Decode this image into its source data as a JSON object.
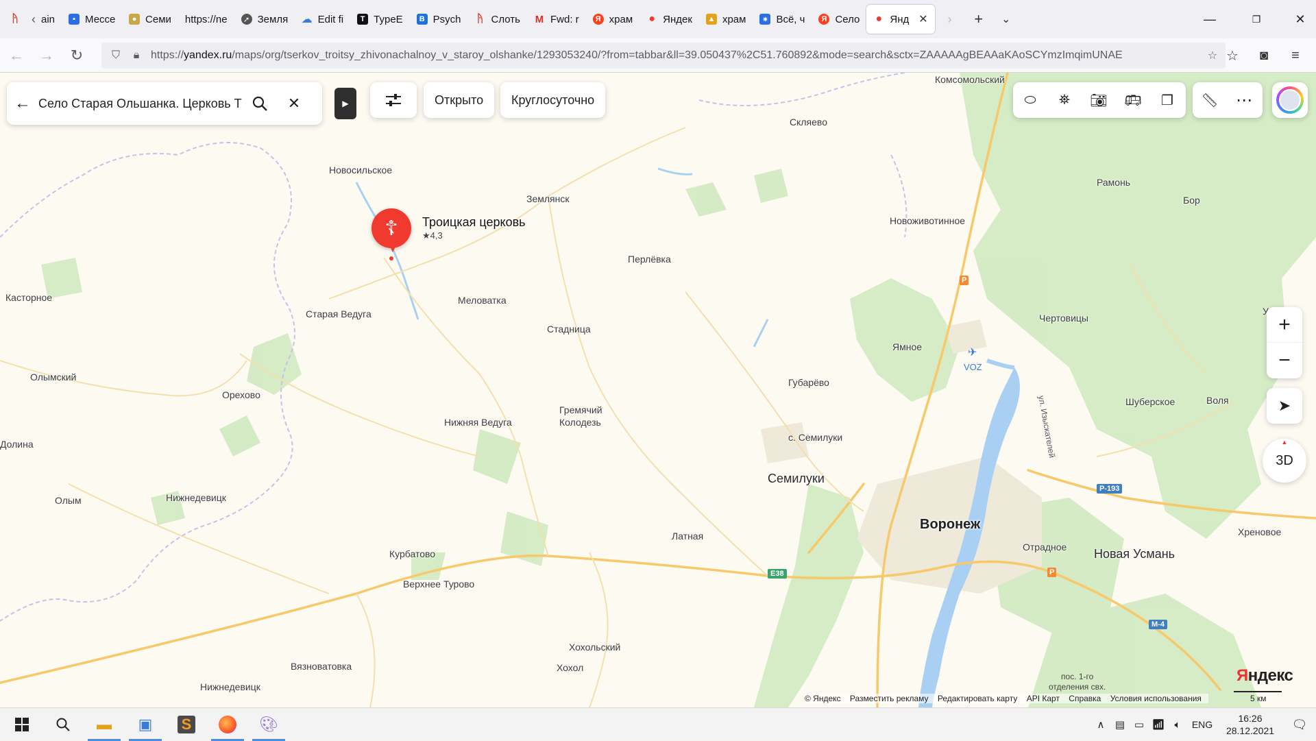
{
  "browser": {
    "tabs": [
      {
        "title": "",
        "icon": "red-figure-icon",
        "color": "#d93a2b"
      },
      {
        "title": "ain",
        "icon": "chevron-left-icon",
        "color": "#555555"
      },
      {
        "title": "Мессе",
        "icon": "message-icon",
        "color": "#2a6ee8"
      },
      {
        "title": "Семи",
        "icon": "bread-icon",
        "color": "#c9a84a"
      },
      {
        "title": "https://ne",
        "icon": "",
        "color": ""
      },
      {
        "title": "Земля",
        "icon": "rocket-icon",
        "color": "#555555"
      },
      {
        "title": "Edit fi",
        "icon": "cloud-icon",
        "color": "#3a7bd5"
      },
      {
        "title": "TypeE",
        "icon": "typeset-icon",
        "color": "#111111"
      },
      {
        "title": "Psych",
        "icon": "psych-icon",
        "color": "#1e73d8"
      },
      {
        "title": "Слоть",
        "icon": "red-figure-icon",
        "color": "#d93a2b"
      },
      {
        "title": "Fwd: r",
        "icon": "gmail-icon",
        "color": "#d93025"
      },
      {
        "title": "храм",
        "icon": "yandex-icon",
        "color": "#fc3f1d"
      },
      {
        "title": "Яндек",
        "icon": "map-pin-icon",
        "color": "#f03a2f"
      },
      {
        "title": "храм",
        "icon": "image-search-icon",
        "color": "#e3a21a"
      },
      {
        "title": "Всё, ч",
        "icon": "sparkle-icon",
        "color": "#2a6ee8"
      },
      {
        "title": "Село",
        "icon": "yandex-icon",
        "color": "#fc3f1d"
      }
    ],
    "active_tab": {
      "title": "Янд",
      "icon": "map-pin-icon",
      "color": "#f03a2f",
      "close": "✕"
    },
    "url": {
      "protocol": "https://",
      "host": "yandex.ru",
      "path": "/maps/org/tserkov_troitsy_zhivonachalnoy_v_staroy_olshanke/1293053240/?from=tabbar&ll=39.050437%2C51.760892&mode=search&sctx=ZAAAAAgBEAAaKAoSCYmzImqimUNAE"
    }
  },
  "map": {
    "search": {
      "value": "Село Старая Ольшанка. Церковь Т"
    },
    "chips": [
      "Открыто",
      "Круглосуточно"
    ],
    "place": {
      "title": "Троицкая церковь",
      "rating": "★4,3"
    },
    "labels": [
      {
        "text": "Комсомольский",
        "kind": "town"
      },
      {
        "text": "Скляево",
        "kind": "town"
      },
      {
        "text": "Новосильское",
        "kind": "town"
      },
      {
        "text": "Землянск",
        "kind": "town"
      },
      {
        "text": "Рамонь",
        "kind": "town"
      },
      {
        "text": "Бор",
        "kind": "town"
      },
      {
        "text": "Новоживотинное",
        "kind": "town"
      },
      {
        "text": "Перлёвка",
        "kind": "town"
      },
      {
        "text": "Касторное",
        "kind": "town"
      },
      {
        "text": "Старая Ведуга",
        "kind": "town"
      },
      {
        "text": "Меловатка",
        "kind": "town"
      },
      {
        "text": "Стадница",
        "kind": "town"
      },
      {
        "text": "Чертовицы",
        "kind": "town"
      },
      {
        "text": "Ямное",
        "kind": "town"
      },
      {
        "text": "Олымский",
        "kind": "town"
      },
      {
        "text": "Орехово",
        "kind": "town"
      },
      {
        "text": "Губарёво",
        "kind": "town"
      },
      {
        "text": "Шуберское",
        "kind": "town"
      },
      {
        "text": "Воля",
        "kind": "town"
      },
      {
        "text": "Нижняя Ведуга",
        "kind": "town"
      },
      {
        "text": "Гремячий",
        "kind": "town"
      },
      {
        "text": "Колодезь",
        "kind": "town"
      },
      {
        "text": "с. Семилуки",
        "kind": "town"
      },
      {
        "text": "Долина",
        "kind": "town"
      },
      {
        "text": "Семилуки",
        "kind": "city"
      },
      {
        "text": "Олым",
        "kind": "town"
      },
      {
        "text": "Нижнедевицк",
        "kind": "town"
      },
      {
        "text": "Латная",
        "kind": "town"
      },
      {
        "text": "Воронеж",
        "kind": "bigcity"
      },
      {
        "text": "Хреновое",
        "kind": "town"
      },
      {
        "text": "Отрадное",
        "kind": "town"
      },
      {
        "text": "Новая Усмань",
        "kind": "city"
      },
      {
        "text": "Курбатово",
        "kind": "town"
      },
      {
        "text": "Верхнее Турово",
        "kind": "town"
      },
      {
        "text": "Хохольский",
        "kind": "town"
      },
      {
        "text": "Хохол",
        "kind": "town"
      },
      {
        "text": "Вязноватовка",
        "kind": "town"
      },
      {
        "text": "Нижнедевицк",
        "kind": "town"
      },
      {
        "text": "VOZ",
        "kind": "airport"
      },
      {
        "text": "ул. Изыскателей",
        "kind": "street"
      },
      {
        "text": "У",
        "kind": "town"
      }
    ],
    "shields": [
      "P-193",
      "E38",
      "M-4",
      "P",
      "P"
    ],
    "note": {
      "line1": "пос. 1-го",
      "line2": "отделения свх."
    },
    "attribution": [
      "© Яндекс",
      "Разместить рекламу",
      "Редактировать карту",
      "API Карт",
      "Справка",
      "Условия использования"
    ],
    "logo": {
      "first": "Я",
      "rest": "ндекс"
    },
    "scale": "5 км",
    "zoom": {
      "in": "+",
      "out": "−"
    },
    "button_3d": "3D"
  },
  "taskbar": {
    "lang": "ENG",
    "time": "16:26",
    "date": "28.12.2021"
  }
}
